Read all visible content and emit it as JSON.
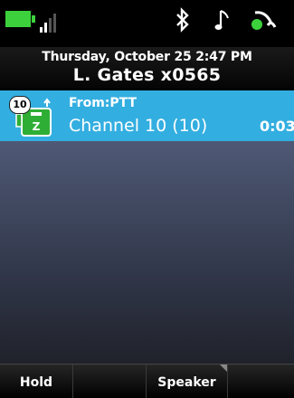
{
  "status_bar": {
    "icons": [
      "battery-icon",
      "signal-icon",
      "bluetooth-icon",
      "ringer-note-icon",
      "headset-icon"
    ],
    "battery_color": "#3cd13c"
  },
  "header": {
    "date_time": "Thursday, October 25 2:47 PM",
    "user_line": "L. Gates x0565"
  },
  "call": {
    "badge": "10",
    "from_label": "From:PTT",
    "channel": "Channel 10 (10)",
    "duration": "0:03",
    "highlight_color": "#33aee0"
  },
  "softkeys": {
    "key1": "Hold",
    "key2": "",
    "key3": "Speaker",
    "key4": ""
  }
}
